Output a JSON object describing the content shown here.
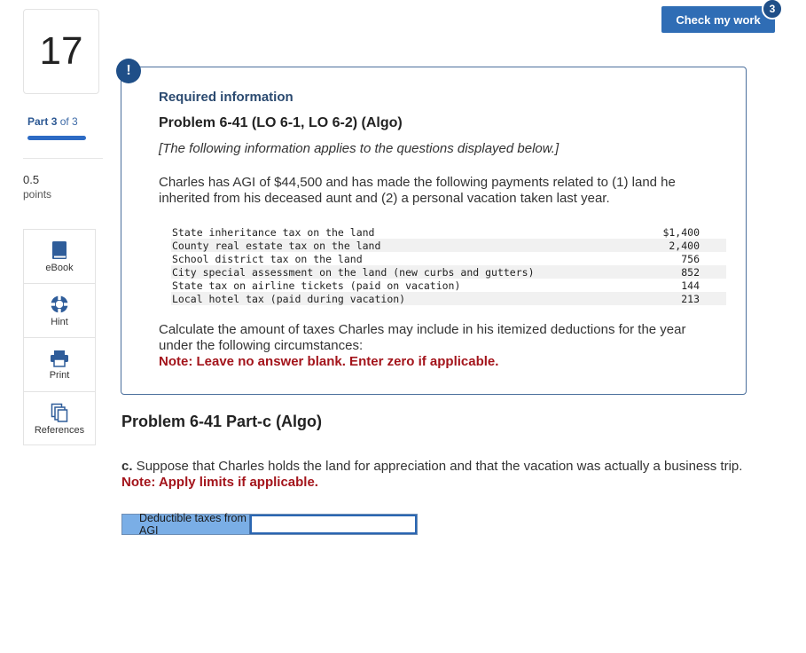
{
  "question": {
    "number": "17"
  },
  "part": {
    "label": "Part",
    "current": "3",
    "of_text": "of 3",
    "progress": 1.0
  },
  "points": {
    "value": "0.5",
    "label": "points"
  },
  "tools": [
    {
      "label": "eBook",
      "icon": "book-icon"
    },
    {
      "label": "Hint",
      "icon": "lifebuoy-icon"
    },
    {
      "label": "Print",
      "icon": "printer-icon"
    },
    {
      "label": "References",
      "icon": "documents-icon"
    }
  ],
  "check": {
    "label": "Check my work",
    "badge": "3"
  },
  "info": {
    "alert_glyph": "!",
    "heading": "Required information",
    "title": "Problem 6-41 (LO 6-1, LO 6-2) (Algo)",
    "italic_note": "[The following information applies to the questions displayed below.]",
    "para1": "Charles has AGI of $44,500 and has made the following payments related to (1) land he inherited from his deceased aunt and (2) a personal vacation taken last year.",
    "rows": [
      {
        "label": "State inheritance tax on the land",
        "amount": "$1,400"
      },
      {
        "label": "County real estate tax on the land",
        "amount": "2,400"
      },
      {
        "label": "School district tax on the land",
        "amount": "756"
      },
      {
        "label": "City special assessment on the land (new curbs and gutters)",
        "amount": "852"
      },
      {
        "label": "State tax on airline tickets (paid on vacation)",
        "amount": "144"
      },
      {
        "label": "Local hotel tax (paid during vacation)",
        "amount": "213"
      }
    ],
    "para2": "Calculate the amount of taxes Charles may include in his itemized deductions for the year under the following circumstances:",
    "note": "Note: Leave no answer blank. Enter zero if applicable."
  },
  "part_c": {
    "title": "Problem 6-41 Part-c (Algo)",
    "prefix": "c.",
    "text": " Suppose that Charles holds the land for appreciation and that the vacation was actually a business trip.",
    "note": "Note: Apply limits if applicable.",
    "answer_label": "Deductible taxes from AGI",
    "answer_value": ""
  }
}
